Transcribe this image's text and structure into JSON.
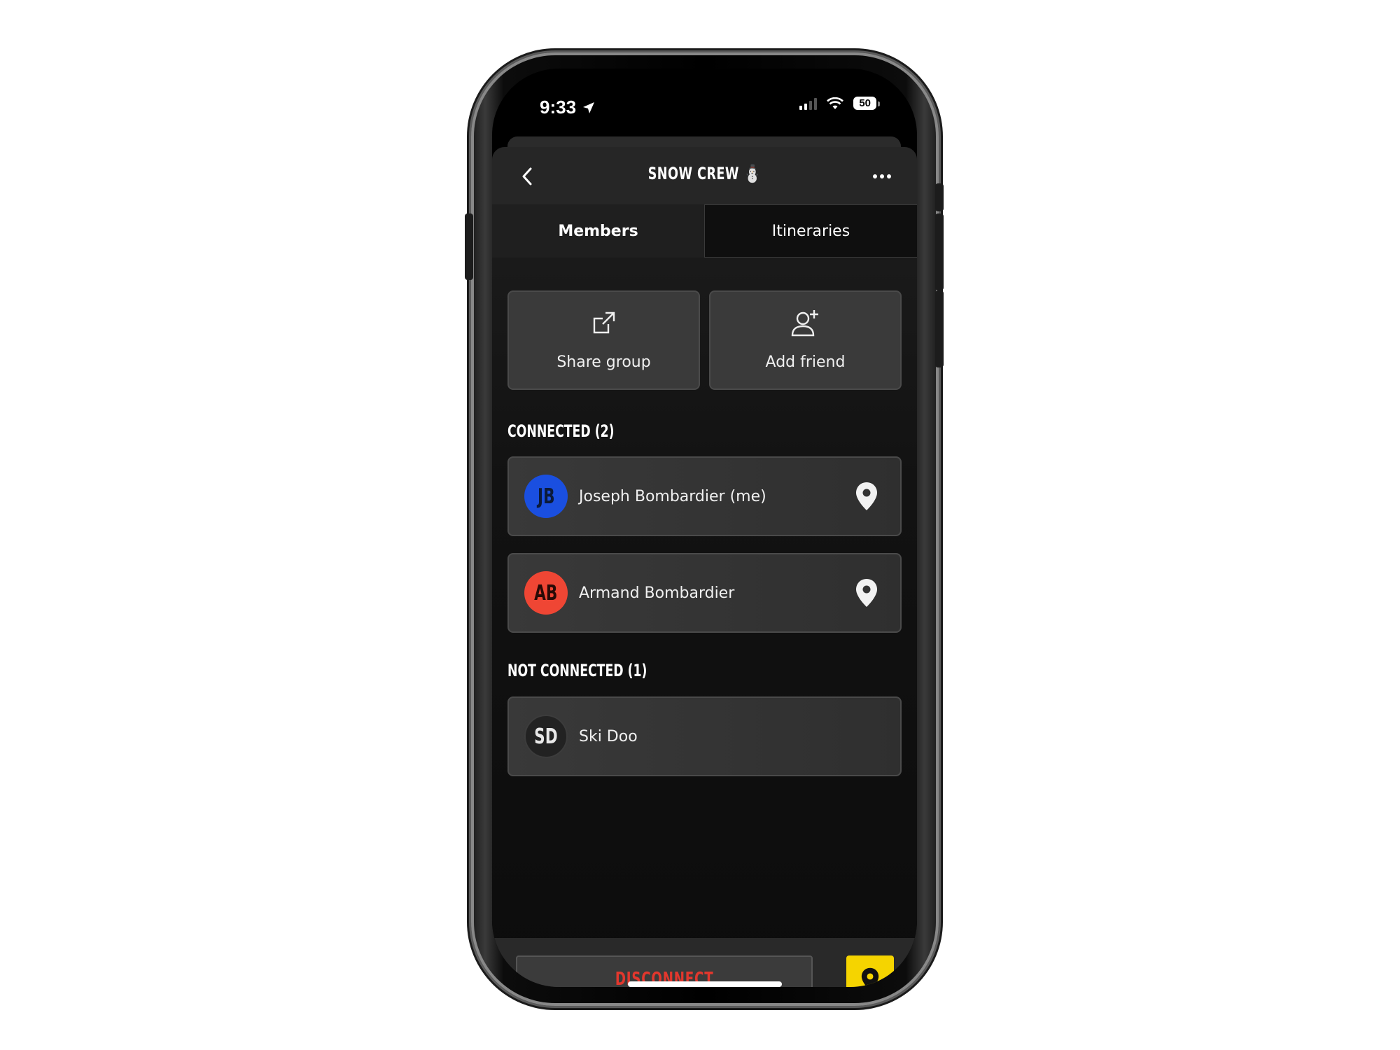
{
  "status_bar": {
    "time": "9:33",
    "battery": "50"
  },
  "header": {
    "title": "SNOW CREW",
    "title_emoji": "⛄"
  },
  "tabs": [
    {
      "label": "Members",
      "active": true
    },
    {
      "label": "Itineraries",
      "active": false
    }
  ],
  "actions": {
    "share_label": "Share group",
    "add_friend_label": "Add friend"
  },
  "connected": {
    "title": "CONNECTED (2)",
    "members": [
      {
        "initials": "JB",
        "name": "Joseph Bombardier (me)",
        "avatar_color": "#1a4fe0",
        "initials_color": "#0b1a3a"
      },
      {
        "initials": "AB",
        "name": "Armand Bombardier",
        "avatar_color": "#ef4634",
        "initials_color": "#2a0a06"
      }
    ]
  },
  "not_connected": {
    "title": "NOT CONNECTED (1)",
    "members": [
      {
        "initials": "SD",
        "name": "Ski Doo",
        "avatar_color": "#222222",
        "initials_color": "#e8e8e8"
      }
    ]
  },
  "footer": {
    "disconnect_label": "DISCONNECT",
    "disconnect_color": "#e2372d",
    "map_button_color": "#f5d400"
  }
}
